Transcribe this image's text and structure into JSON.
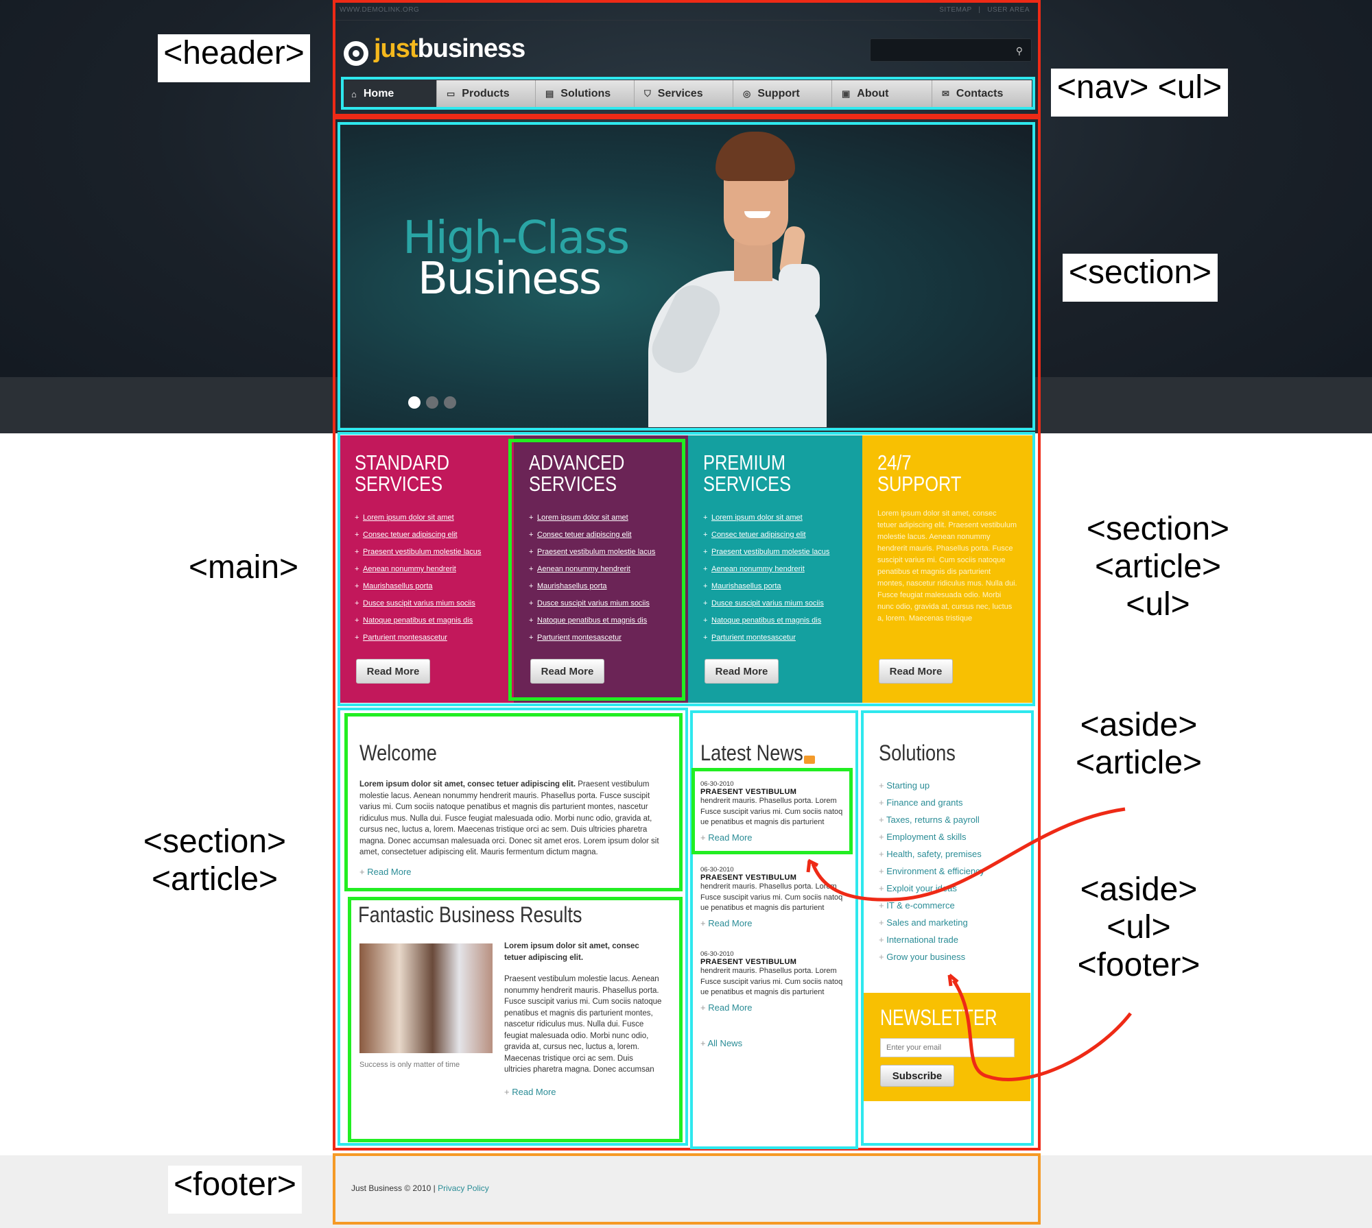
{
  "topbar": {
    "site": "WWW.DEMOLINK.ORG",
    "links": "SITEMAP   |   USER AREA"
  },
  "logo": {
    "part1": "just",
    "part2": "business"
  },
  "search": {
    "placeholder": ""
  },
  "nav": [
    {
      "label": "Home",
      "icon": "home-icon",
      "glyph": "⌂"
    },
    {
      "label": "Products",
      "icon": "products-icon",
      "glyph": "▭"
    },
    {
      "label": "Solutions",
      "icon": "solutions-icon",
      "glyph": "▤"
    },
    {
      "label": "Services",
      "icon": "services-icon",
      "glyph": "⛉"
    },
    {
      "label": "Support",
      "icon": "support-icon",
      "glyph": "◎"
    },
    {
      "label": "About",
      "icon": "about-icon",
      "glyph": "▣"
    },
    {
      "label": "Contacts",
      "icon": "contacts-icon",
      "glyph": "✉"
    }
  ],
  "hero": {
    "line1": "High-Class",
    "line2": "Business",
    "active_slide": 1,
    "slides": 3
  },
  "services": [
    {
      "title": "STANDARD\nSERVICES",
      "color": "#c2185b",
      "items": [
        "Lorem ipsum dolor sit amet",
        "Consec tetuer adipiscing elit",
        "Praesent vestibulum molestie lacus",
        "Aenean nonummy hendrerit",
        "Maurishasellus porta",
        "Dusce suscipit varius mium sociis",
        "Natoque penatibus et magnis dis",
        "Parturient montesascetur"
      ],
      "button": "Read More"
    },
    {
      "title": "ADVANCED\nSERVICES",
      "color": "#6b2456",
      "items": [
        "Lorem ipsum dolor sit amet",
        "Consec tetuer adipiscing elit",
        "Praesent vestibulum molestie lacus",
        "Aenean nonummy hendrerit",
        "Maurishasellus porta",
        "Dusce suscipit varius mium sociis",
        "Natoque penatibus et magnis dis",
        "Parturient montesascetur"
      ],
      "button": "Read More"
    },
    {
      "title": "PREMIUM\nSERVICES",
      "color": "#14a0a0",
      "items": [
        "Lorem ipsum dolor sit amet",
        "Consec tetuer adipiscing elit",
        "Praesent vestibulum molestie lacus",
        "Aenean nonummy hendrerit",
        "Maurishasellus porta",
        "Dusce suscipit varius mium sociis",
        "Natoque penatibus et magnis dis",
        "Parturient montesascetur"
      ],
      "button": "Read More"
    },
    {
      "title": "24/7\nSUPPORT",
      "color": "#f8c002",
      "text": "Lorem ipsum dolor sit amet, consec tetuer adipiscing elit. Praesent vestibulum molestie lacus. Aenean nonummy hendrerit mauris. Phasellus porta. Fusce suscipit varius mi. Cum sociis natoque penatibus et magnis dis parturient montes, nascetur ridiculus mus. Nulla dui. Fusce feugiat malesuada odio. Morbi nunc odio, gravida at, cursus nec, luctus a, lorem. Maecenas tristique",
      "button": "Read More"
    }
  ],
  "welcome": {
    "title": "Welcome",
    "lead": "Lorem ipsum dolor sit amet, consec tetuer adipiscing elit.",
    "body": " Praesent vestibulum molestie lacus. Aenean nonummy hendrerit mauris. Phasellus porta. Fusce suscipit varius mi. Cum sociis natoque penatibus et magnis dis parturient montes, nascetur ridiculus mus. Nulla dui. Fusce feugiat malesuada odio. Morbi nunc odio, gravida at, cursus nec, luctus a, lorem. Maecenas tristique orci ac sem. Duis ultricies pharetra magna. Donec accumsan malesuada orci. Donec sit amet eros. Lorem ipsum dolor sit amet, consectetuer adipiscing elit. Mauris fermentum dictum magna.",
    "more": "Read More"
  },
  "results": {
    "title": "Fantastic Business Results",
    "lead": "Lorem ipsum dolor sit amet, consec tetuer adipiscing elit.",
    "body": "Praesent vestibulum molestie lacus. Aenean nonummy hendrerit mauris. Phasellus porta. Fusce suscipit varius mi. Cum sociis natoque penatibus et magnis dis parturient montes, nascetur ridiculus mus. Nulla dui. Fusce feugiat malesuada odio. Morbi nunc odio, gravida at, cursus nec, luctus a, lorem. Maecenas tristique orci ac sem. Duis ultricies pharetra magna. Donec accumsan",
    "caption": "Success is only matter of time",
    "more": "Read More"
  },
  "news": {
    "title": "Latest News",
    "items": [
      {
        "date": "06-30-2010",
        "title": "PRAESENT VESTIBULUM",
        "text": "hendrerit mauris. Phasellus porta. Lorem Fusce suscipit varius mi. Cum sociis natoq ue penatibus et magnis dis parturient",
        "more": "Read More"
      },
      {
        "date": "06-30-2010",
        "title": "PRAESENT VESTIBULUM",
        "text": "hendrerit mauris. Phasellus porta. Lorem Fusce suscipit varius mi. Cum sociis natoq ue penatibus et magnis dis parturient",
        "more": "Read More"
      },
      {
        "date": "06-30-2010",
        "title": "PRAESENT VESTIBULUM",
        "text": "hendrerit mauris. Phasellus porta. Lorem Fusce suscipit varius mi. Cum sociis natoq ue penatibus et magnis dis parturient",
        "more": "Read More"
      }
    ],
    "all": "All News"
  },
  "solutions": {
    "title": "Solutions",
    "items": [
      "Starting up",
      "Finance and grants",
      "Taxes, returns & payroll",
      "Employment & skills",
      "Health, safety, premises",
      "Environment & efficiency",
      "Exploit your ideas",
      "IT & e-commerce",
      "Sales and marketing",
      "International trade",
      "Grow your business"
    ]
  },
  "newsletter": {
    "title": "NEWSLETTER",
    "placeholder": "Enter your email",
    "button": "Subscribe"
  },
  "footer": {
    "copyright": "Just Business © 2010",
    "separator": "|",
    "privacy": "Privacy Policy"
  },
  "annotations": {
    "header": "<header>",
    "nav": "<nav> <ul>",
    "section_hero": "<section>",
    "main": "<main>",
    "services": "<section>\n<article>\n<ul>",
    "content": "<section>\n<article>",
    "aside1": "<aside>\n<article>",
    "aside2": "<aside>\n<ul>\n<footer>",
    "footer": "<footer>"
  },
  "colors": {
    "accent_teal": "#2a8c96",
    "accent_yellow": "#f4b81d",
    "overlay_red": "#ee2a16",
    "overlay_cyan": "#2ee8ee",
    "overlay_green": "#22ee22",
    "overlay_orange": "#f59a26"
  }
}
